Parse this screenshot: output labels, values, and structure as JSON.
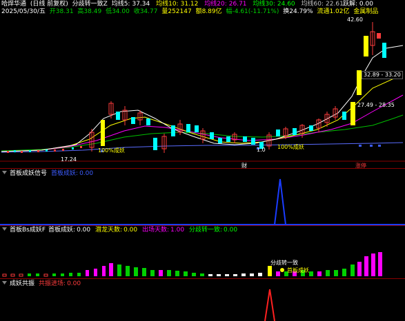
{
  "header": {
    "stock_name": "哈焊华通",
    "period": "(日线 前复权)",
    "indicator_name": "分歧转一致Z",
    "ma": [
      {
        "label": "均线5:",
        "value": "37.34",
        "color": "#ffffff"
      },
      {
        "label": "均线10:",
        "value": "31.12",
        "color": "#ffff00"
      },
      {
        "label": "均线20:",
        "value": "26.71",
        "color": "#ff00ff"
      },
      {
        "label": "均线30:",
        "value": "24.60",
        "color": "#00ff00"
      },
      {
        "label": "均线60:",
        "value": "22.61",
        "color": "#c0c0c0"
      }
    ],
    "right_label": "跃解: 0.00",
    "colors": {
      "red": "#ff3c3c",
      "green": "#00d000",
      "white": "#ffffff",
      "yellow": "#ffff00",
      "magenta": "#ff00ff",
      "cyan": "#00ffff"
    }
  },
  "info_row": {
    "date": "2025/05/30/五",
    "open": "开38.31",
    "high": "高38.49",
    "low": "低34.00",
    "close": "收34.77",
    "volume": "量252147",
    "amount": "额8.89亿",
    "change": "幅-4.61(-11.71%)",
    "turnover": "换24.79%",
    "float_shares": "流通1.02亿",
    "industry": "金属制品"
  },
  "price_chart": {
    "labels": {
      "high": "42.60",
      "low": "17.24",
      "tag_upper": "32.89 - 33.20",
      "tag_lower": "27.49 - 28.35",
      "ann_left": "100%成妖",
      "ann_right": "100%成妖",
      "ann_buy": "1.0",
      "marker_cai": "财",
      "marker_board": "涨停"
    }
  },
  "panel1": {
    "title": "首板成妖信号",
    "sub_label": "首板成妖:",
    "sub_value": "0.00"
  },
  "panel2": {
    "title": "首板Bs成妖F",
    "items": [
      {
        "label": "首板成妖:",
        "value": "0.00",
        "color": "#ffffff"
      },
      {
        "label": "潜龙天数:",
        "value": "0.00",
        "color": "#ffff00"
      },
      {
        "label": "出场天数:",
        "value": "1.00",
        "color": "#ff00ff"
      },
      {
        "label": "分歧转一致:",
        "value": "0.00",
        "color": "#00ff00"
      }
    ],
    "annotations": {
      "a1": "分歧转一致",
      "a2": "首板成妖"
    }
  },
  "panel3": {
    "title": "成妖共振",
    "sub_label": "共振进场:",
    "sub_value": "0.00"
  }
}
